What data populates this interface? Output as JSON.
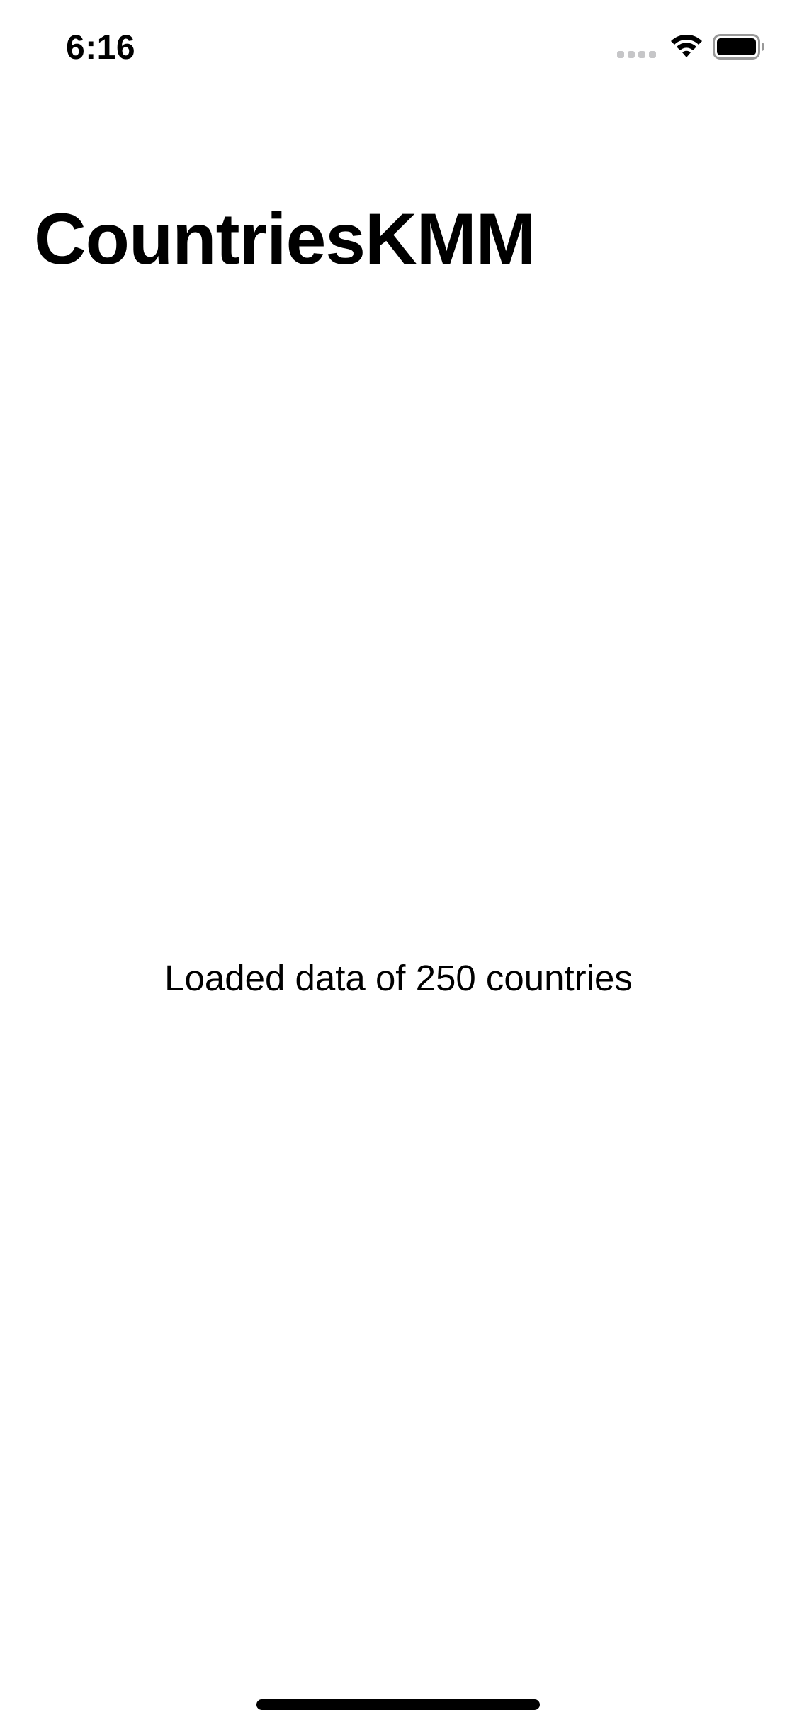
{
  "status_bar": {
    "time": "6:16",
    "icons": [
      "cellular-signal-icon",
      "wifi-icon",
      "battery-icon"
    ]
  },
  "navigation": {
    "title": "CountriesKMM"
  },
  "content": {
    "message": "Loaded data of 250 countries"
  },
  "colors": {
    "background": "#ffffff",
    "text": "#000000",
    "inactive_signal": "#c6c6c8"
  }
}
